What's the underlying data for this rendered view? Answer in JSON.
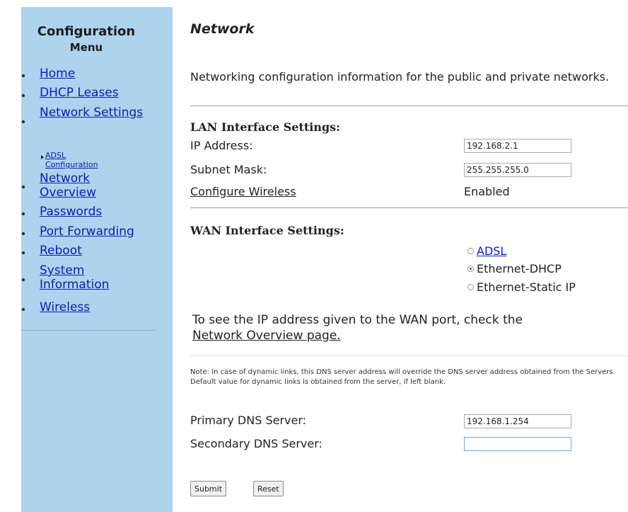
{
  "sidebar": {
    "title_line1": "Configuration",
    "title_line2": "Menu",
    "items": [
      {
        "label": "Home"
      },
      {
        "label": "DHCP Leases"
      },
      {
        "label": "Network Settings"
      },
      {
        "label": "ADSL Configuration"
      },
      {
        "label": "Network Overview"
      },
      {
        "label": "Passwords"
      },
      {
        "label": "Port Forwarding"
      },
      {
        "label": "Reboot"
      },
      {
        "label": "System Information"
      },
      {
        "label": "Wireless"
      }
    ]
  },
  "main": {
    "title": "Network",
    "description": "Networking configuration information for the public and private networks.",
    "lan": {
      "heading": "LAN Interface Settings:",
      "ip_label": "IP Address:",
      "ip_value": "192.168.2.1",
      "mask_label": "Subnet Mask:",
      "mask_value": "255.255.255.0",
      "wireless_link": "Configure Wireless",
      "wireless_status": "Enabled"
    },
    "wan": {
      "heading": "WAN Interface Settings:",
      "options": [
        {
          "label": "ADSL",
          "selected": false
        },
        {
          "label": "Ethernet-DHCP",
          "selected": true
        },
        {
          "label": "Ethernet-Static IP",
          "selected": false
        }
      ],
      "info_text": "To see the IP address given to the WAN port, check the",
      "info_link": "Network Overview page."
    },
    "dns": {
      "note": "Note: In case of dynamic links, this DNS server address will override the DNS server address obtained from the Servers. Default value for dynamic links is obtained from the server, if left blank.",
      "primary_label": "Primary DNS Server:",
      "primary_value": "192.168.1.254",
      "secondary_label": "Secondary DNS Server:",
      "secondary_value": ""
    },
    "buttons": {
      "submit": "Submit",
      "reset": "Reset"
    }
  }
}
